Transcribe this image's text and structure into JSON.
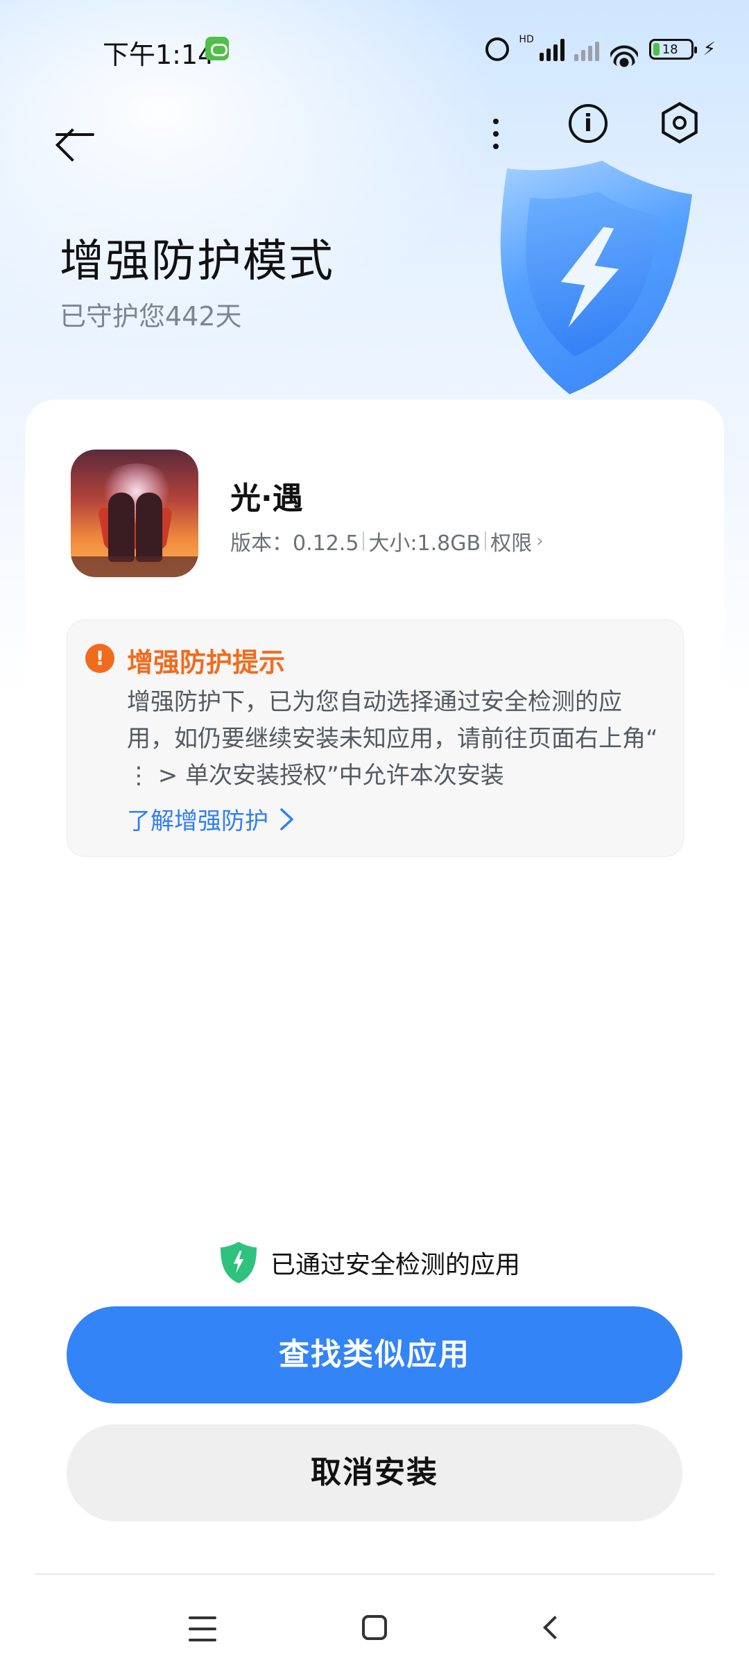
{
  "status_bar": {
    "time": "下午1:14",
    "network_label": "HD",
    "battery_percent": "18",
    "icons": [
      "chat-notification-icon",
      "alarm-icon",
      "signal-icon",
      "wifi-icon",
      "battery-icon",
      "charging-icon"
    ]
  },
  "header": {
    "title": "增强防护模式",
    "subtitle": "已守护您442天",
    "actions": [
      "back-arrow-icon",
      "more-options-icon",
      "info-icon",
      "settings-icon"
    ]
  },
  "app": {
    "name": "光·遇",
    "version_label": "版本：0.12.5",
    "size_label": "大小:1.8GB",
    "permissions_label": "权限"
  },
  "notice": {
    "title": "增强防护提示",
    "body": "增强防护下，已为您自动选择通过安全检测的应用，如仍要继续安装未知应用，请前往页面右上角“ ⋮ > 单次安装授权”中允许本次安装",
    "link": "了解增强防护"
  },
  "footer": {
    "passed_text": "已通过安全检测的应用",
    "primary_button": "查找类似应用",
    "secondary_button": "取消安装"
  },
  "colors": {
    "accent": "#3384f6",
    "warning": "#f26b1d",
    "success": "#2ec27e"
  }
}
